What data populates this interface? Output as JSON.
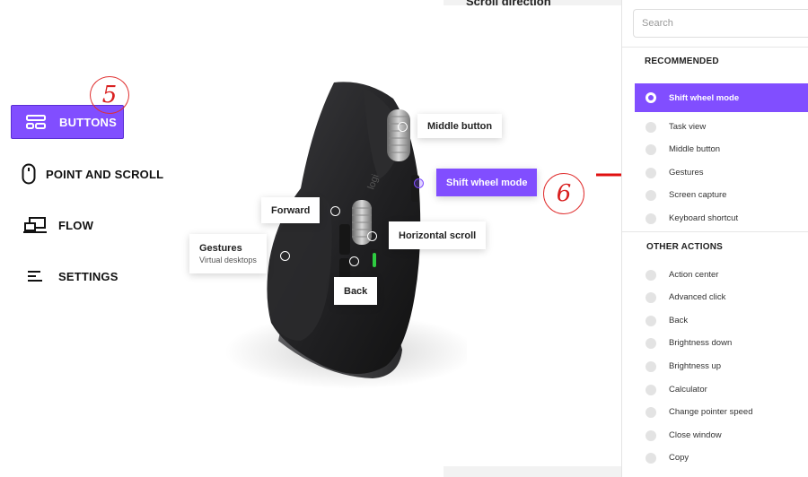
{
  "top_partial_heading": "Scroll direction",
  "nav": {
    "items": [
      {
        "label": "BUTTONS",
        "icon": "buttons-icon",
        "active": true
      },
      {
        "label": "POINT AND SCROLL",
        "icon": "mouse-icon",
        "active": false
      },
      {
        "label": "FLOW",
        "icon": "flow-icon",
        "active": false
      },
      {
        "label": "SETTINGS",
        "icon": "settings-icon",
        "active": false
      }
    ]
  },
  "annotations": {
    "five": "5",
    "six": "6"
  },
  "mouse_callouts": {
    "middle": "Middle button",
    "shift": "Shift wheel mode",
    "forward": "Forward",
    "horizontal": "Horizontal scroll",
    "gestures": "Gestures",
    "gestures_sub": "Virtual desktops",
    "back": "Back"
  },
  "panel": {
    "search_placeholder": "Search",
    "recommended_heading": "RECOMMENDED",
    "recommended": [
      "Shift wheel mode",
      "Task view",
      "Middle button",
      "Gestures",
      "Screen capture",
      "Keyboard shortcut"
    ],
    "other_heading": "OTHER ACTIONS",
    "other": [
      "Action center",
      "Advanced click",
      "Back",
      "Brightness down",
      "Brightness up",
      "Calculator",
      "Change pointer speed",
      "Close window",
      "Copy"
    ]
  },
  "colors": {
    "accent": "#814eff",
    "annotation": "#e03030"
  }
}
